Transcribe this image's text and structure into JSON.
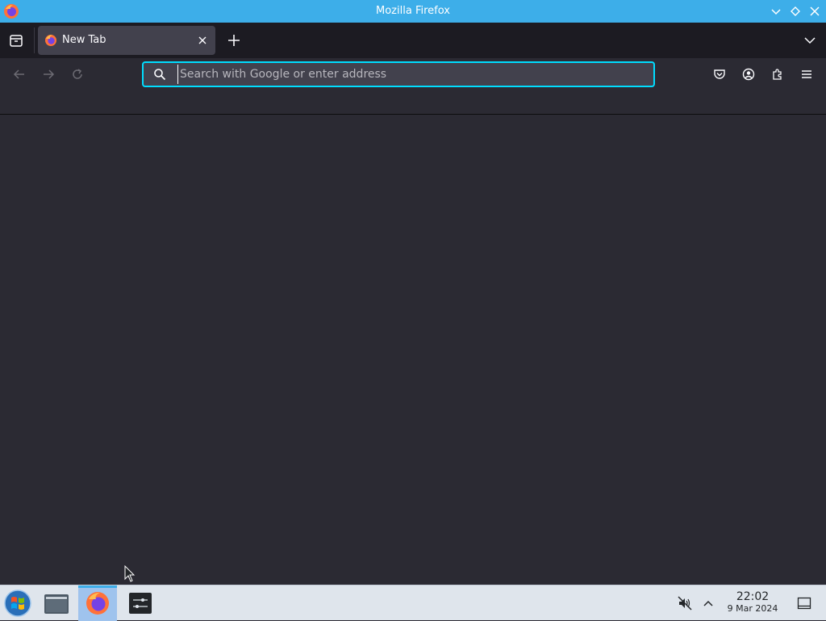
{
  "window": {
    "title": "Mozilla Firefox"
  },
  "tabs": [
    {
      "label": "New Tab",
      "active": true
    }
  ],
  "urlbar": {
    "placeholder": "Search with Google or enter address",
    "value": ""
  },
  "icons": {
    "app": "firefox-icon",
    "minimize": "chevron-down-icon",
    "maximize": "diamond-icon",
    "close": "close-icon",
    "tab_manager": "tab-manager-icon",
    "new_tab": "plus-icon",
    "list_tabs": "chevron-down-icon",
    "back": "arrow-left-icon",
    "forward": "arrow-right-icon",
    "reload": "reload-icon",
    "search": "search-icon",
    "pocket": "pocket-icon",
    "account": "account-icon",
    "extensions": "puzzle-icon",
    "menu": "hamburger-menu-icon"
  },
  "taskbar": {
    "items": [
      "file-manager",
      "firefox",
      "settings"
    ],
    "active_item": "firefox",
    "clock": {
      "time": "22:02",
      "date": "9 Mar 2024"
    },
    "tray": [
      "volume-muted-icon",
      "chevron-up-icon",
      "show-desktop-icon"
    ]
  },
  "colors": {
    "titlebar": "#3daee9",
    "urlbar_focus": "#00ddff",
    "content_bg": "#2b2a33",
    "tabstrip_bg": "#1c1b22",
    "taskbar_bg": "#dfe5ec"
  }
}
